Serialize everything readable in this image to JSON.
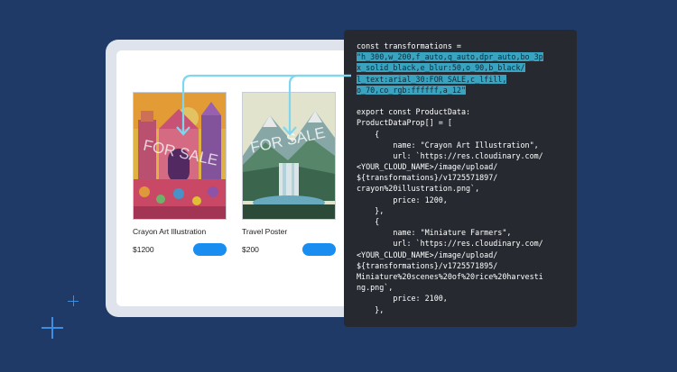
{
  "products": [
    {
      "name": "Crayon Art Illustration",
      "price": "$1200"
    },
    {
      "name": "Travel Poster",
      "price": "$200"
    }
  ],
  "posters": {
    "overlay_text": "FOR SALE"
  },
  "code": {
    "highlighted": [
      "\"h_300,w_200,f_auto,q_auto,dpr_auto,bo_3p",
      "x_solid_black,e_blur:50,o_90,b_black/",
      "l_text:arial_30:FOR SALE,c_lfill,",
      "o_70,co_rgb:ffffff,a_12\""
    ],
    "top": [
      "const transformations ="
    ],
    "body": [
      "export const ProductData:",
      "ProductDataProp[] = [",
      "    {",
      "        name: \"Crayon Art Illustration\",",
      "        url: `https://res.cloudinary.com/",
      "<YOUR_CLOUD_NAME>/image/upload/",
      "${transformations}/v1725571897/",
      "crayon%20illustration.png`,",
      "        price: 1200,",
      "    },",
      "    {",
      "        name: \"Miniature Farmers\",",
      "        url: `https://res.cloudinary.com/",
      "<YOUR_CLOUD_NAME>/image/upload/",
      "${transformations}/v1725571895/",
      "Miniature%20scenes%20of%20rice%20harvesti",
      "ng.png`,",
      "        price: 2100,",
      "    },"
    ]
  },
  "colors": {
    "background": "#1f3a66",
    "accent": "#1a8ef0",
    "highlight": "#3aa3c0"
  }
}
